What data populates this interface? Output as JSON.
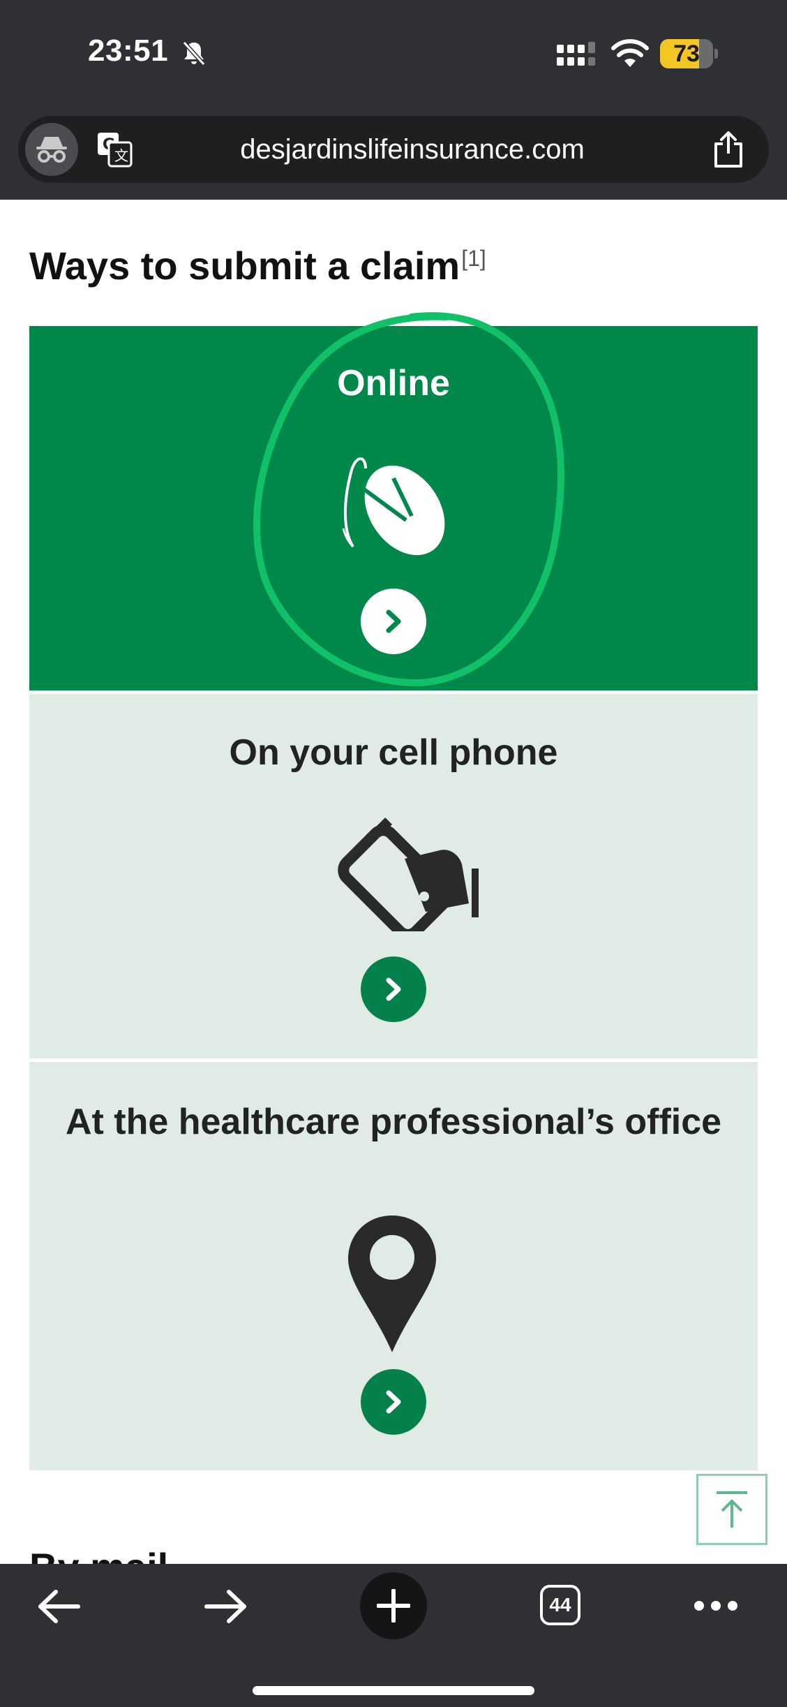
{
  "status_bar": {
    "time": "23:51",
    "battery": "73"
  },
  "browser": {
    "url": "desjardinslifeinsurance.com",
    "tab_count": "44"
  },
  "page": {
    "heading": "Ways to submit a claim",
    "heading_ref": "[1]",
    "cards": [
      {
        "title": "Online"
      },
      {
        "title": "On your cell phone"
      },
      {
        "title": "At the healthcare professional’s office"
      }
    ],
    "next_section_peek": "By mail"
  },
  "colors": {
    "brand_green": "#00874a",
    "card_light": "#e0ebe6",
    "annotation_green": "#11c168"
  }
}
